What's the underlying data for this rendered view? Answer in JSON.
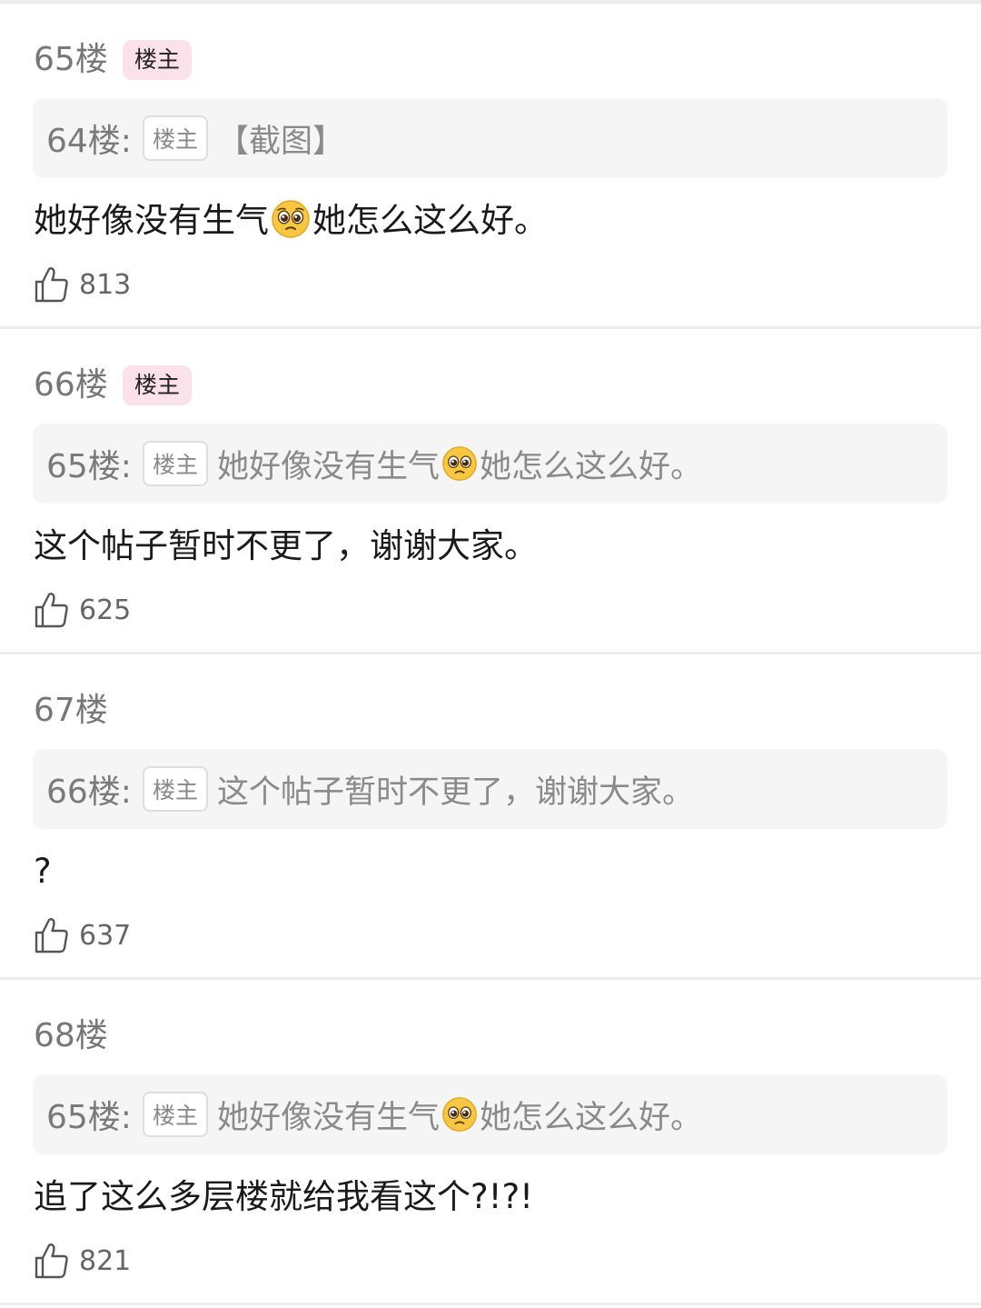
{
  "floors": [
    {
      "floor_label": "65楼",
      "badge": "楼主",
      "quote": {
        "ref": "64楼:",
        "badge": "楼主",
        "text_before": "【截图】",
        "emoji": "",
        "text_after": ""
      },
      "content": {
        "before": "她好像没有生气",
        "emoji": "pleading-face",
        "after": "她怎么这么好。"
      },
      "likes": "813"
    },
    {
      "floor_label": "66楼",
      "badge": "楼主",
      "quote": {
        "ref": "65楼:",
        "badge": "楼主",
        "text_before": "她好像没有生气",
        "emoji": "pleading-face",
        "text_after": "她怎么这么好。"
      },
      "content": {
        "before": "这个帖子暂时不更了，谢谢大家。",
        "emoji": "",
        "after": ""
      },
      "likes": "625"
    },
    {
      "floor_label": "67楼",
      "badge": "",
      "quote": {
        "ref": "66楼:",
        "badge": "楼主",
        "text_before": "这个帖子暂时不更了，谢谢大家。",
        "emoji": "",
        "text_after": ""
      },
      "content": {
        "before": "?",
        "emoji": "",
        "after": ""
      },
      "likes": "637"
    },
    {
      "floor_label": "68楼",
      "badge": "",
      "quote": {
        "ref": "65楼:",
        "badge": "楼主",
        "text_before": "她好像没有生气",
        "emoji": "pleading-face",
        "text_after": "她怎么这么好。"
      },
      "content": {
        "before": "追了这么多层楼就给我看这个?!?!",
        "emoji": "",
        "after": ""
      },
      "likes": "821"
    }
  ],
  "colors": {
    "op_badge_bg": "#fbe1ea",
    "quote_bg": "#f5f5f5",
    "divider": "#ececec"
  }
}
